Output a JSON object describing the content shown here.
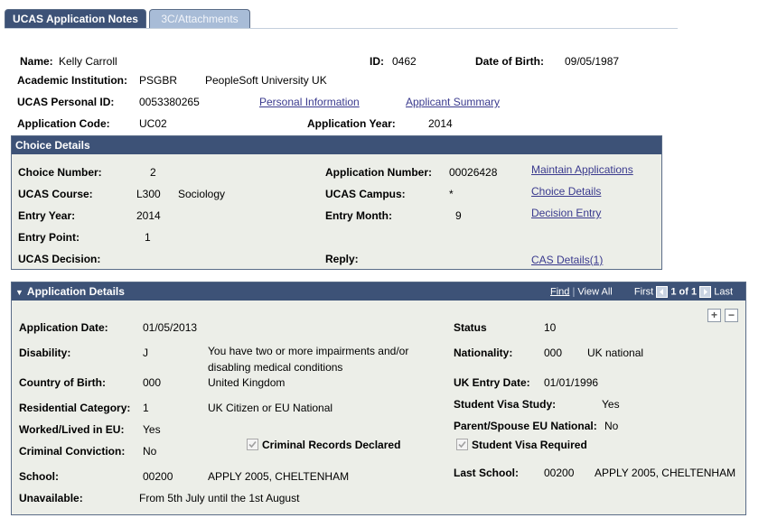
{
  "tabs": {
    "active": "UCAS Application Notes",
    "other": "3C/Attachments"
  },
  "applicant": {
    "name_label": "Name:",
    "name": "Kelly Carroll",
    "id_label": "ID:",
    "id": "0462",
    "dob_label": "Date of Birth:",
    "dob": "09/05/1987",
    "institution_label": "Academic Institution:",
    "institution_code": "PSGBR",
    "institution_name": "PeopleSoft University UK",
    "ucas_pid_label": "UCAS Personal ID:",
    "ucas_pid": "0053380265",
    "personal_info_link": "Personal Information",
    "applicant_summary_link": "Applicant Summary",
    "app_code_label": "Application Code:",
    "app_code": "UC02",
    "app_year_label": "Application Year:",
    "app_year": "2014"
  },
  "choice": {
    "header": "Choice Details",
    "choice_no_label": "Choice Number:",
    "choice_no": "2",
    "app_no_label": "Application Number:",
    "app_no": "00026428",
    "maintain_link": "Maintain Applications",
    "course_label": "UCAS Course:",
    "course_code": "L300",
    "course_name": "Sociology",
    "campus_label": "UCAS Campus:",
    "campus": "*",
    "choice_details_link": "Choice Details",
    "entry_year_label": "Entry Year:",
    "entry_year": "2014",
    "entry_month_label": "Entry Month:",
    "entry_month": "9",
    "decision_entry_link": "Decision Entry",
    "entry_point_label": "Entry Point:",
    "entry_point": "1",
    "decision_label": "UCAS Decision:",
    "reply_label": "Reply:",
    "cas_link": "CAS Details(1)"
  },
  "details": {
    "header": "Application Details",
    "nav": {
      "find": "Find",
      "view_all": "View All",
      "first": "First",
      "count": "1 of 1",
      "last": "Last"
    },
    "app_date_label": "Application Date:",
    "app_date": "01/05/2013",
    "status_label": "Status",
    "status": "10",
    "disability_label": "Disability:",
    "disability_code": "J",
    "disability_desc_1": "You have two or more impairments and/or",
    "disability_desc_2": "disabling medical conditions",
    "nationality_label": "Nationality:",
    "nationality_code": "000",
    "nationality_desc": "UK national",
    "cob_label": "Country of Birth:",
    "cob_code": "000",
    "cob_desc": "United Kingdom",
    "uk_entry_label": "UK Entry Date:",
    "uk_entry": "01/01/1996",
    "res_cat_label": "Residential Category:",
    "res_cat_code": "1",
    "res_cat_desc": "UK Citizen or EU National",
    "visa_study_label": "Student Visa Study:",
    "visa_study": "Yes",
    "worked_label": "Worked/Lived in EU:",
    "worked": "Yes",
    "parent_eu_label": "Parent/Spouse EU National:",
    "parent_eu": "No",
    "criminal_label": "Criminal Conviction:",
    "criminal": "No",
    "criminal_records_label": "Criminal Records Declared",
    "visa_required_label": "Student Visa Required",
    "school_label": "School:",
    "school_code": "00200",
    "school_name": "APPLY 2005, CHELTENHAM",
    "last_school_label": "Last School:",
    "last_school_code": "00200",
    "last_school_name": "APPLY 2005, CHELTENHAM",
    "unavailable_label": "Unavailable:",
    "unavailable": "From 5th July until the 1st August"
  },
  "colors": {
    "header_bg": "#3d5277",
    "box_bg": "#eceee8",
    "tab_inactive": "#a8bcd7",
    "link": "#3a3a8e"
  }
}
